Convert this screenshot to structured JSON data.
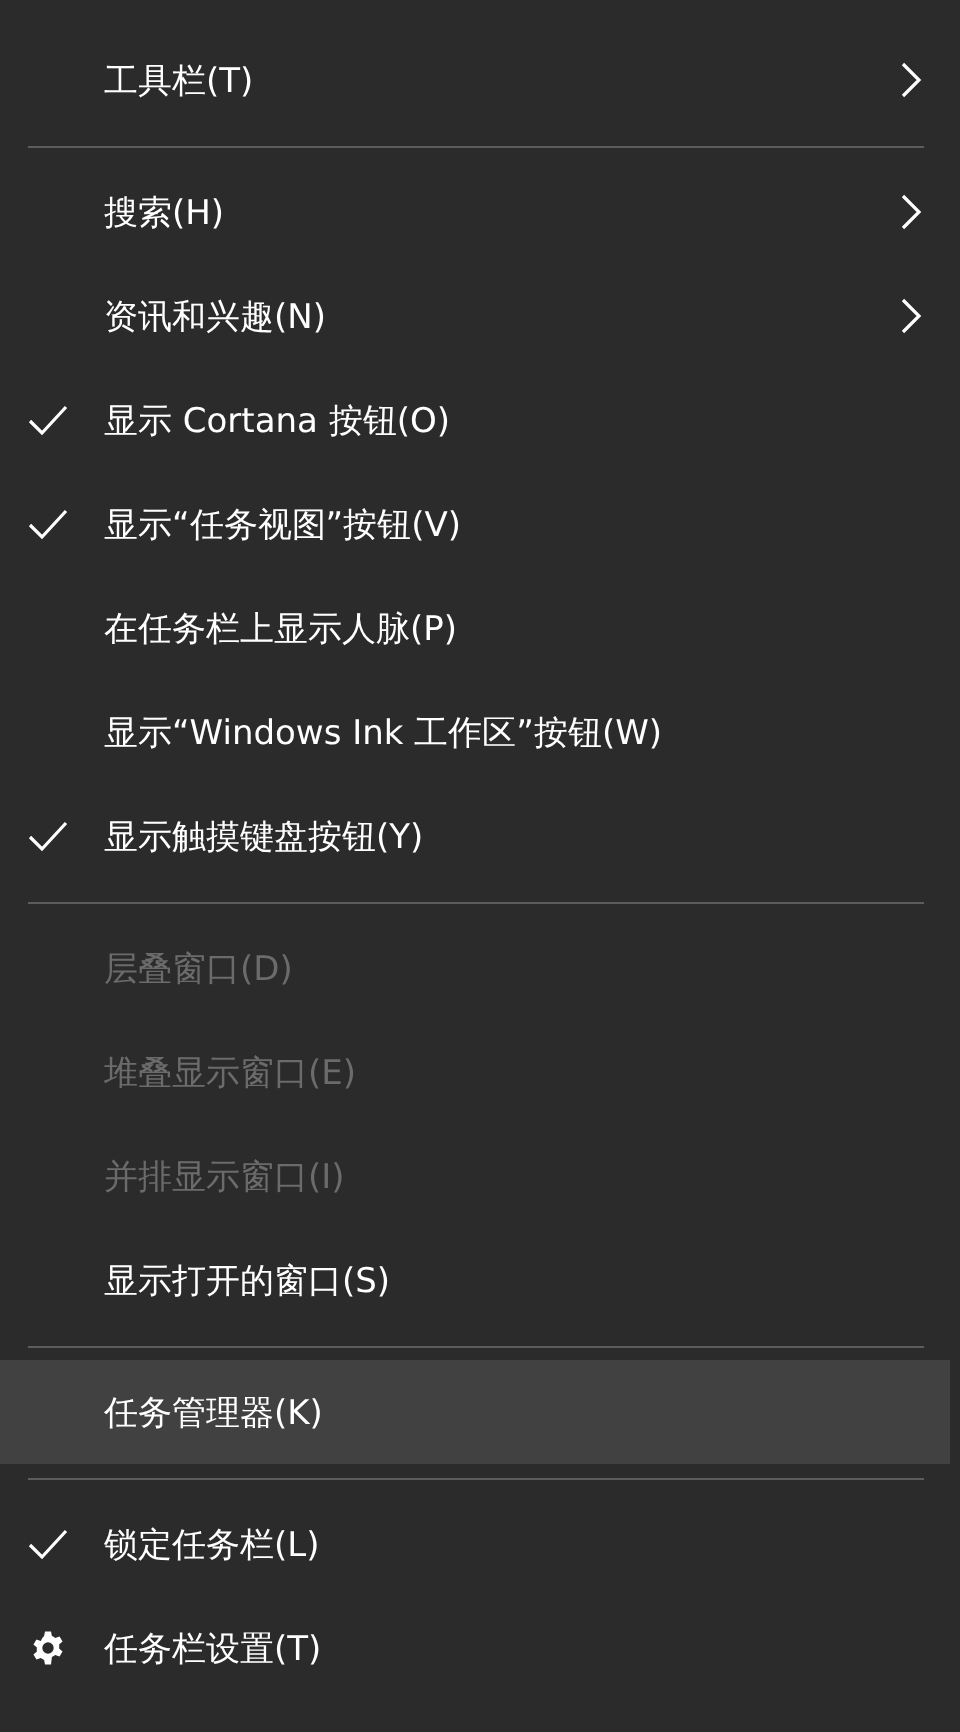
{
  "menu": {
    "items": [
      {
        "kind": "item",
        "label": "工具栏(T)",
        "checked": false,
        "disabled": false,
        "selected": false,
        "submenu": true
      },
      {
        "kind": "separator"
      },
      {
        "kind": "item",
        "label": "搜索(H)",
        "checked": false,
        "disabled": false,
        "selected": false,
        "submenu": true
      },
      {
        "kind": "item",
        "label": "资讯和兴趣(N)",
        "checked": false,
        "disabled": false,
        "selected": false,
        "submenu": true
      },
      {
        "kind": "item",
        "label": "显示 Cortana 按钮(O)",
        "checked": true,
        "disabled": false,
        "selected": false,
        "submenu": false
      },
      {
        "kind": "item",
        "label": "显示“任务视图”按钮(V)",
        "checked": true,
        "disabled": false,
        "selected": false,
        "submenu": false
      },
      {
        "kind": "item",
        "label": "在任务栏上显示人脉(P)",
        "checked": false,
        "disabled": false,
        "selected": false,
        "submenu": false
      },
      {
        "kind": "item",
        "label": "显示“Windows Ink 工作区”按钮(W)",
        "checked": false,
        "disabled": false,
        "selected": false,
        "submenu": false
      },
      {
        "kind": "item",
        "label": "显示触摸键盘按钮(Y)",
        "checked": true,
        "disabled": false,
        "selected": false,
        "submenu": false
      },
      {
        "kind": "separator"
      },
      {
        "kind": "item",
        "label": "层叠窗口(D)",
        "checked": false,
        "disabled": true,
        "selected": false,
        "submenu": false
      },
      {
        "kind": "item",
        "label": "堆叠显示窗口(E)",
        "checked": false,
        "disabled": true,
        "selected": false,
        "submenu": false
      },
      {
        "kind": "item",
        "label": "并排显示窗口(I)",
        "checked": false,
        "disabled": true,
        "selected": false,
        "submenu": false
      },
      {
        "kind": "item",
        "label": "显示打开的窗口(S)",
        "checked": false,
        "disabled": false,
        "selected": false,
        "submenu": false
      },
      {
        "kind": "separator"
      },
      {
        "kind": "item",
        "label": "任务管理器(K)",
        "checked": false,
        "disabled": false,
        "selected": true,
        "submenu": false
      },
      {
        "kind": "separator"
      },
      {
        "kind": "item",
        "label": "锁定任务栏(L)",
        "checked": true,
        "disabled": false,
        "selected": false,
        "submenu": false
      },
      {
        "kind": "settings",
        "label": "任务栏设置(T)",
        "disabled": false,
        "selected": false,
        "submenu": false
      }
    ]
  }
}
